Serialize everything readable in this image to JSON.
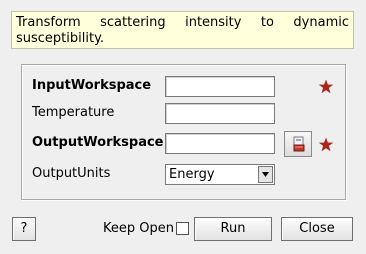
{
  "description": "Transform scattering intensity to dynamic susceptibility.",
  "form": {
    "input_workspace": {
      "label": "InputWorkspace",
      "value": "",
      "required": true
    },
    "temperature": {
      "label": "Temperature",
      "value": ""
    },
    "output_workspace": {
      "label": "OutputWorkspace",
      "value": "",
      "required": true
    },
    "output_units": {
      "label": "OutputUnits",
      "selected": "Energy"
    }
  },
  "footer": {
    "help_label": "?",
    "keep_open_label": "Keep Open",
    "keep_open_checked": false,
    "run_label": "Run",
    "close_label": "Close"
  },
  "colors": {
    "description_bg": "#ffffdc",
    "required_star": "#a8261c"
  },
  "icons": {
    "required": "star-icon",
    "browse": "workspace-browse-icon",
    "dropdown": "triangle-down-icon"
  }
}
